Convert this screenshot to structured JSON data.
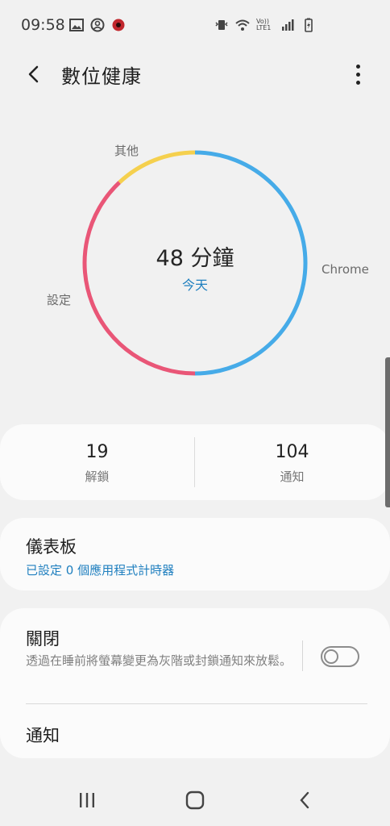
{
  "status_bar": {
    "time": "09:58",
    "left_icons": [
      "gallery-icon",
      "account-circle-icon",
      "app-badge-icon"
    ],
    "right_icons": [
      "vibrate-icon",
      "wifi-icon",
      "volte-lte-icon",
      "signal-icon",
      "battery-charging-icon"
    ],
    "volte_text": "Vo)) LTE1"
  },
  "app_bar": {
    "title": "數位健康"
  },
  "usage_chart": {
    "center_value": "48 分鐘",
    "center_period": "今天",
    "segments": [
      {
        "label": "Chrome",
        "color": "#46abe8",
        "fraction": 0.5
      },
      {
        "label": "設定",
        "color": "#e95677",
        "fraction": 0.38
      },
      {
        "label": "其他",
        "color": "#f5d04e",
        "fraction": 0.12
      }
    ]
  },
  "stats": {
    "unlocks": {
      "value": "19",
      "label": "解鎖"
    },
    "notifications": {
      "value": "104",
      "label": "通知"
    }
  },
  "dashboard": {
    "title": "儀表板",
    "subtitle": "已設定 0 個應用程式計時器"
  },
  "wind_down": {
    "title": "關閉",
    "description": "透過在睡前將螢幕變更為灰階或封鎖通知來放鬆。",
    "enabled": false
  },
  "notifications_row": {
    "title": "通知"
  },
  "colors": {
    "accent_blue": "#1f7fbf",
    "background": "#f1f1f1",
    "card": "#fbfbfb"
  }
}
